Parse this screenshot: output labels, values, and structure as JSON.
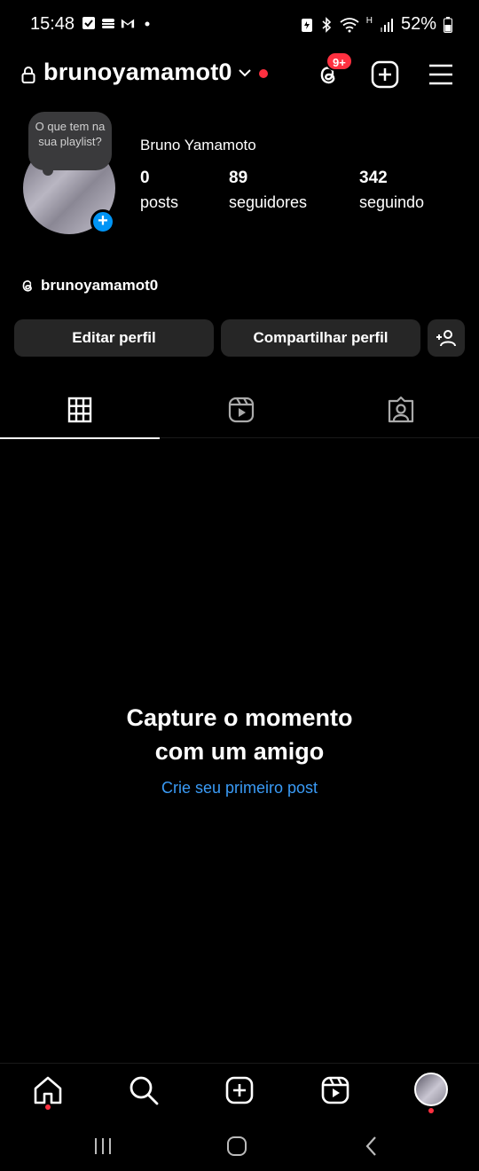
{
  "status_bar": {
    "time": "15:48",
    "battery": "52%",
    "network_type": "H"
  },
  "header": {
    "username": "brunoyamamot0",
    "notification_badge": "9+"
  },
  "profile": {
    "note_bubble": "O que tem na sua playlist?",
    "full_name": "Bruno Yamamoto",
    "stats": [
      {
        "value": "0",
        "label": "posts"
      },
      {
        "value": "89",
        "label": "seguidores"
      },
      {
        "value": "342",
        "label": "seguindo"
      }
    ],
    "threads_handle": "brunoyamamot0"
  },
  "actions": {
    "edit_label": "Editar perfil",
    "share_label": "Compartilhar perfil"
  },
  "tabs": [
    {
      "icon": "grid-icon",
      "active": true
    },
    {
      "icon": "reels-icon",
      "active": false
    },
    {
      "icon": "tagged-icon",
      "active": false
    }
  ],
  "empty_state": {
    "title_line1": "Capture o momento",
    "title_line2": "com um amigo",
    "cta": "Crie seu primeiro post"
  },
  "bottom_nav": [
    "home-icon",
    "search-icon",
    "create-icon",
    "reels-icon",
    "profile-avatar"
  ],
  "colors": {
    "background": "#000000",
    "button_bg": "#262626",
    "accent_blue": "#0095f6",
    "link_blue": "#3a9bf6",
    "badge_red": "#ff3040"
  }
}
